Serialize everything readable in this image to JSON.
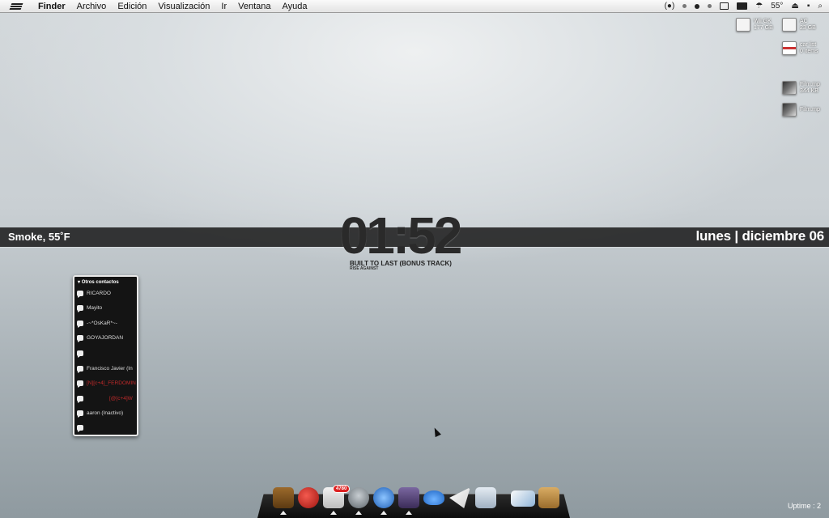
{
  "menubar": {
    "app_name": "Finder",
    "menus": [
      "Archivo",
      "Edición",
      "Visualización",
      "Ir",
      "Ventana",
      "Ayuda"
    ],
    "status_temp": "55°"
  },
  "desktop_icons": [
    {
      "label_1": "Wii GK",
      "label_2": "177 GB",
      "icon": "drive-icon"
    },
    {
      "label_1": "AC",
      "label_2": "23 GB",
      "icon": "drive-icon"
    },
    {
      "label_1": "car list",
      "label_2": "0 items",
      "icon": "document-icon"
    },
    {
      "label_1": "Film.mp",
      "label_2": "344 KB",
      "icon": "photo-icon"
    },
    {
      "label_1": "Film.mp",
      "label_2": "",
      "icon": "photo-icon"
    }
  ],
  "widgets": {
    "weather": "Smoke, 55˚F",
    "date": "lunes | diciembre 06",
    "clock": "01:52",
    "track": "BUILT TO LAST (BONUS TRACK)",
    "artist": "RISE AGAINST",
    "uptime": "Uptime : 2"
  },
  "contacts": {
    "header": "Otros contactos",
    "items": [
      {
        "name": "RICARDO",
        "style": "normal"
      },
      {
        "name": "Mayito",
        "style": "normal"
      },
      {
        "name": "-~*OsKaR*~-",
        "style": "normal"
      },
      {
        "name": "GOYAJORDAN",
        "style": "normal"
      },
      {
        "name": "",
        "style": "normal"
      },
      {
        "name": "Francisco Javier  (In",
        "style": "normal"
      },
      {
        "name": "[N][c+4]_FERDOMIN",
        "style": "red"
      },
      {
        "name": "[@[c+4]W",
        "style": "red"
      },
      {
        "name": "aaron  (Inactivo)",
        "style": "normal"
      },
      {
        "name": "",
        "style": "normal"
      }
    ]
  },
  "dock": {
    "mail_badge": "4780",
    "items": [
      {
        "name": "dashboard-icon",
        "color": "#7a4d1c"
      },
      {
        "name": "apple-icon",
        "color": "#c4231c"
      },
      {
        "name": "mail-icon",
        "color": "#d9d9d9"
      },
      {
        "name": "adium-duck-icon",
        "color": "#8a939a"
      },
      {
        "name": "itunes-icon",
        "color": "#3a7fd0"
      },
      {
        "name": "screen-icon",
        "color": "#5b4a7c"
      },
      {
        "name": "cloud-icon",
        "color": "#3d86d6"
      },
      {
        "name": "mail-plane-icon",
        "color": "#e9e9e9"
      },
      {
        "name": "clipboard-icon",
        "color": "#c8d2dc"
      },
      {
        "name": "photo-viewer-icon",
        "color": "#f0f0f0"
      },
      {
        "name": "package-icon",
        "color": "#c89a52"
      }
    ]
  }
}
